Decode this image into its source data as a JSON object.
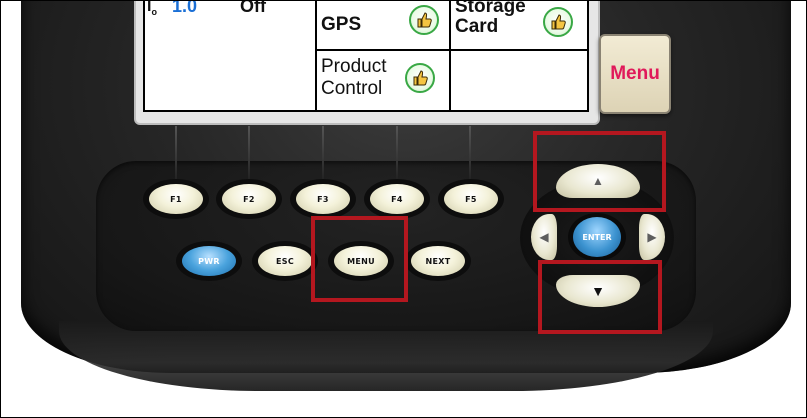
{
  "screen": {
    "status_left_value": "1.0",
    "status_left_value_color": "#1a6fd6",
    "status_left_state": "Off",
    "cells": [
      {
        "label_line1": "GPS",
        "label_line2": "",
        "icon": "thumbs-up-icon"
      },
      {
        "label_line1": "Storage",
        "label_line2": "Card",
        "icon": "thumbs-up-icon"
      },
      {
        "label_line1": "Product",
        "label_line2": "Control",
        "icon": "thumbs-up-icon"
      }
    ],
    "softkey_label": "Menu",
    "softkey_color": "#e0195a"
  },
  "keys": {
    "function": [
      "F1",
      "F2",
      "F3",
      "F4",
      "F5"
    ],
    "pwr": "PWR",
    "esc": "ESC",
    "menu": "MENU",
    "next": "NEXT",
    "enter": "ENTER"
  },
  "highlight_color": "#b4171f"
}
